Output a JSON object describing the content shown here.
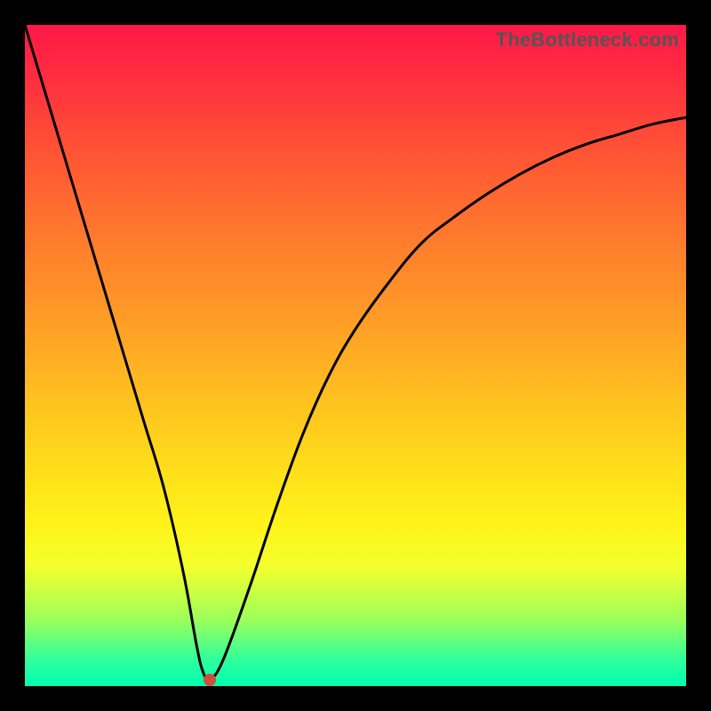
{
  "watermark": "TheBottleneck.com",
  "chart_data": {
    "type": "line",
    "title": "",
    "xlabel": "",
    "ylabel": "",
    "xlim": [
      0,
      100
    ],
    "ylim": [
      0,
      100
    ],
    "grid": false,
    "legend": false,
    "series": [
      {
        "name": "curve",
        "x": [
          0,
          3,
          6,
          9,
          12,
          15,
          18,
          21,
          24,
          26,
          27,
          28,
          30,
          34,
          38,
          42,
          46,
          50,
          55,
          60,
          65,
          70,
          75,
          80,
          85,
          90,
          95,
          100
        ],
        "values": [
          100,
          90,
          80,
          70,
          60,
          50,
          40,
          30,
          17,
          6,
          2,
          1,
          4,
          15,
          27,
          38,
          47,
          54,
          61,
          67,
          71,
          74.5,
          77.5,
          80,
          82,
          83.5,
          85,
          86
        ]
      }
    ],
    "annotations": [
      {
        "type": "point",
        "name": "minimum-marker",
        "x": 28,
        "y": 1,
        "color": "#cf4f3e"
      }
    ]
  }
}
